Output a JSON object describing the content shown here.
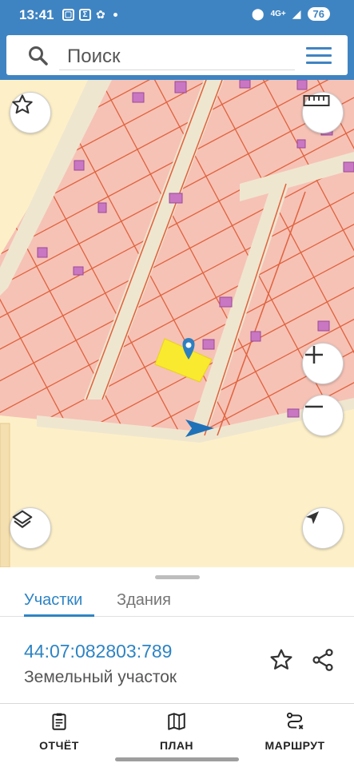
{
  "status_bar": {
    "time": "13:41",
    "notif_icons": [
      "screenshot-icon",
      "sigma-icon",
      "apps-icon"
    ],
    "network": "4G+",
    "battery": "76"
  },
  "search": {
    "placeholder": "Поиск",
    "search_icon": "search-icon",
    "menu_icon": "menu-icon"
  },
  "map": {
    "controls": {
      "favorite": "star-icon",
      "ruler": "ruler-icon",
      "zoom_in": "plus-icon",
      "zoom_out": "minus-icon",
      "layers": "layers-icon",
      "locate": "navigation-arrow-icon"
    },
    "colors": {
      "background": "#fdf0c8",
      "parcel_fill": "#f6c2b6",
      "parcel_border": "#e0623d",
      "building": "#c977c2",
      "road": "#efe6d0",
      "selected_parcel": "#f9ea2f",
      "marker": "#2d7fc0"
    }
  },
  "sheet": {
    "tabs": [
      {
        "label": "Участки",
        "active": true
      },
      {
        "label": "Здания",
        "active": false
      }
    ],
    "parcel": {
      "id": "44:07:082803:789",
      "type": "Земельный участок"
    },
    "actions": [
      "star-outline-icon",
      "share-icon"
    ]
  },
  "bottom_nav": [
    {
      "label": "ОТЧЁТ",
      "icon": "clipboard-icon"
    },
    {
      "label": "ПЛАН",
      "icon": "map-icon"
    },
    {
      "label": "МАРШРУТ",
      "icon": "route-icon"
    }
  ]
}
